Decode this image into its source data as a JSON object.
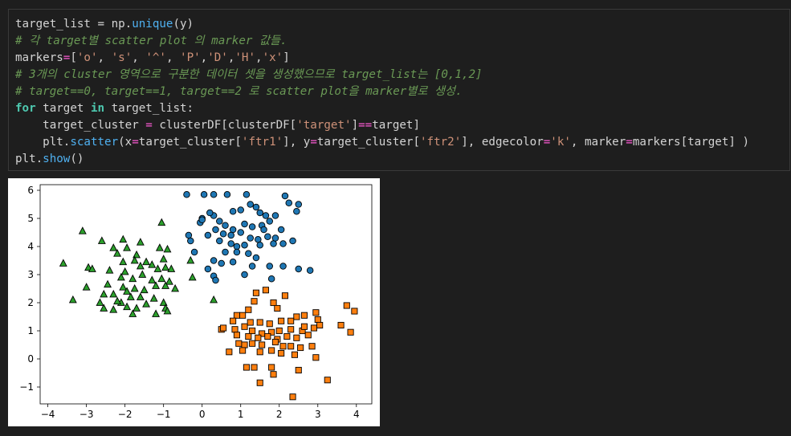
{
  "code_cell": {
    "lines": [
      [
        {
          "t": "target_list = np.",
          "c": "n"
        },
        {
          "t": "unique",
          "c": "fn"
        },
        {
          "t": "(y)",
          "c": "n"
        }
      ],
      [
        {
          "t": "# 각 target별 scatter plot 의 marker 값들.",
          "c": "c"
        }
      ],
      [
        {
          "t": "markers",
          "c": "n"
        },
        {
          "t": "=",
          "c": "o"
        },
        {
          "t": "[",
          "c": "n"
        },
        {
          "t": "'o'",
          "c": "s"
        },
        {
          "t": ", ",
          "c": "n"
        },
        {
          "t": "'s'",
          "c": "s"
        },
        {
          "t": ", ",
          "c": "n"
        },
        {
          "t": "'^'",
          "c": "s"
        },
        {
          "t": ", ",
          "c": "n"
        },
        {
          "t": "'P'",
          "c": "s"
        },
        {
          "t": ",",
          "c": "n"
        },
        {
          "t": "'D'",
          "c": "s"
        },
        {
          "t": ",",
          "c": "n"
        },
        {
          "t": "'H'",
          "c": "s"
        },
        {
          "t": ",",
          "c": "n"
        },
        {
          "t": "'x'",
          "c": "s"
        },
        {
          "t": "]",
          "c": "n"
        }
      ],
      [
        {
          "t": "# 3개의 cluster 영역으로 구분한 데이터 셋을 생성했으므로 target_list는 [0,1,2]",
          "c": "c"
        }
      ],
      [
        {
          "t": "# target==0, target==1, target==2 로 scatter plot을 marker별로 생성.",
          "c": "c"
        }
      ],
      [
        {
          "t": "for",
          "c": "k"
        },
        {
          "t": " target ",
          "c": "n"
        },
        {
          "t": "in",
          "c": "k"
        },
        {
          "t": " target_list:",
          "c": "n"
        }
      ],
      [
        {
          "t": "    target_cluster ",
          "c": "n"
        },
        {
          "t": "=",
          "c": "o"
        },
        {
          "t": " clusterDF[clusterDF[",
          "c": "n"
        },
        {
          "t": "'target'",
          "c": "s"
        },
        {
          "t": "]",
          "c": "n"
        },
        {
          "t": "==",
          "c": "o"
        },
        {
          "t": "target]",
          "c": "n"
        }
      ],
      [
        {
          "t": "    plt.",
          "c": "n"
        },
        {
          "t": "scatter",
          "c": "fn"
        },
        {
          "t": "(x",
          "c": "n"
        },
        {
          "t": "=",
          "c": "o"
        },
        {
          "t": "target_cluster[",
          "c": "n"
        },
        {
          "t": "'ftr1'",
          "c": "s"
        },
        {
          "t": "], y",
          "c": "n"
        },
        {
          "t": "=",
          "c": "o"
        },
        {
          "t": "target_cluster[",
          "c": "n"
        },
        {
          "t": "'ftr2'",
          "c": "s"
        },
        {
          "t": "], edgecolor",
          "c": "n"
        },
        {
          "t": "=",
          "c": "o"
        },
        {
          "t": "'k'",
          "c": "s"
        },
        {
          "t": ", marker",
          "c": "n"
        },
        {
          "t": "=",
          "c": "o"
        },
        {
          "t": "markers[target] )",
          "c": "n"
        }
      ],
      [
        {
          "t": "plt.",
          "c": "n"
        },
        {
          "t": "show",
          "c": "fn"
        },
        {
          "t": "()",
          "c": "n"
        }
      ]
    ]
  },
  "chart_data": {
    "type": "scatter",
    "xlim": [
      -4.2,
      4.4
    ],
    "ylim": [
      -1.6,
      6.2
    ],
    "xticks": [
      -4,
      -3,
      -2,
      -1,
      0,
      1,
      2,
      3,
      4
    ],
    "yticks": [
      -1,
      0,
      1,
      2,
      3,
      4,
      5,
      6
    ],
    "grid": false,
    "series": [
      {
        "marker": "o",
        "color": "#1f77b4",
        "points": [
          [
            -0.4,
            5.85
          ],
          [
            0.05,
            5.85
          ],
          [
            0.3,
            5.85
          ],
          [
            0.65,
            5.85
          ],
          [
            1.15,
            5.85
          ],
          [
            2.15,
            5.8
          ],
          [
            2.25,
            5.55
          ],
          [
            2.5,
            5.5
          ],
          [
            1.25,
            5.5
          ],
          [
            1.4,
            5.4
          ],
          [
            1.0,
            5.3
          ],
          [
            0.8,
            5.25
          ],
          [
            1.5,
            5.2
          ],
          [
            1.65,
            5.1
          ],
          [
            1.9,
            5.1
          ],
          [
            2.45,
            5.25
          ],
          [
            0.3,
            5.1
          ],
          [
            0.2,
            5.2
          ],
          [
            0.0,
            5.0
          ],
          [
            -0.05,
            4.85
          ],
          [
            0.45,
            4.9
          ],
          [
            0.6,
            4.75
          ],
          [
            0.8,
            4.6
          ],
          [
            1.1,
            4.8
          ],
          [
            1.3,
            4.7
          ],
          [
            1.55,
            4.75
          ],
          [
            1.75,
            4.9
          ],
          [
            2.05,
            4.6
          ],
          [
            0.35,
            4.6
          ],
          [
            0.15,
            4.4
          ],
          [
            0.55,
            4.45
          ],
          [
            0.75,
            4.4
          ],
          [
            1.0,
            4.5
          ],
          [
            1.25,
            4.3
          ],
          [
            1.45,
            4.25
          ],
          [
            1.7,
            4.35
          ],
          [
            0.45,
            4.2
          ],
          [
            0.75,
            4.1
          ],
          [
            0.9,
            4.0
          ],
          [
            1.1,
            4.05
          ],
          [
            1.5,
            4.05
          ],
          [
            1.85,
            4.1
          ],
          [
            2.1,
            4.1
          ],
          [
            0.6,
            3.8
          ],
          [
            0.9,
            3.8
          ],
          [
            1.2,
            3.75
          ],
          [
            1.4,
            3.6
          ],
          [
            0.3,
            3.5
          ],
          [
            0.5,
            3.4
          ],
          [
            0.8,
            3.45
          ],
          [
            1.3,
            3.3
          ],
          [
            1.75,
            3.3
          ],
          [
            2.1,
            3.3
          ],
          [
            0.15,
            3.2
          ],
          [
            1.1,
            3.0
          ],
          [
            2.5,
            3.2
          ],
          [
            2.8,
            3.15
          ],
          [
            0.3,
            2.95
          ],
          [
            0.35,
            2.8
          ],
          [
            1.8,
            2.85
          ],
          [
            -0.2,
            3.8
          ],
          [
            -0.3,
            4.2
          ],
          [
            -0.35,
            4.4
          ],
          [
            0.0,
            4.95
          ],
          [
            1.6,
            4.6
          ],
          [
            1.9,
            4.3
          ],
          [
            2.35,
            4.2
          ]
        ]
      },
      {
        "marker": "s",
        "color": "#ff7f0e",
        "points": [
          [
            1.65,
            2.45
          ],
          [
            1.4,
            2.35
          ],
          [
            2.15,
            2.25
          ],
          [
            1.35,
            2.05
          ],
          [
            1.85,
            2.0
          ],
          [
            1.95,
            1.8
          ],
          [
            1.2,
            1.75
          ],
          [
            2.65,
            1.55
          ],
          [
            3.75,
            1.9
          ],
          [
            3.95,
            1.7
          ],
          [
            0.9,
            1.55
          ],
          [
            1.05,
            1.55
          ],
          [
            2.45,
            1.5
          ],
          [
            2.95,
            1.65
          ],
          [
            0.8,
            1.35
          ],
          [
            1.5,
            1.3
          ],
          [
            1.75,
            1.25
          ],
          [
            2.05,
            1.35
          ],
          [
            2.3,
            1.35
          ],
          [
            3.0,
            1.4
          ],
          [
            3.6,
            1.2
          ],
          [
            0.5,
            1.05
          ],
          [
            0.85,
            1.05
          ],
          [
            1.1,
            1.15
          ],
          [
            1.3,
            1.0
          ],
          [
            1.55,
            0.9
          ],
          [
            1.8,
            0.95
          ],
          [
            2.0,
            1.0
          ],
          [
            2.3,
            1.05
          ],
          [
            2.6,
            1.0
          ],
          [
            2.9,
            1.1
          ],
          [
            3.85,
            0.95
          ],
          [
            0.9,
            0.85
          ],
          [
            1.2,
            0.8
          ],
          [
            1.45,
            0.75
          ],
          [
            1.7,
            0.8
          ],
          [
            1.95,
            0.7
          ],
          [
            2.2,
            0.8
          ],
          [
            2.45,
            0.75
          ],
          [
            2.75,
            0.85
          ],
          [
            0.95,
            0.55
          ],
          [
            1.1,
            0.5
          ],
          [
            1.3,
            0.55
          ],
          [
            1.55,
            0.5
          ],
          [
            1.9,
            0.6
          ],
          [
            2.1,
            0.45
          ],
          [
            2.3,
            0.45
          ],
          [
            2.55,
            0.4
          ],
          [
            2.85,
            0.45
          ],
          [
            0.7,
            0.25
          ],
          [
            1.05,
            0.3
          ],
          [
            1.5,
            0.25
          ],
          [
            1.8,
            0.3
          ],
          [
            2.05,
            0.2
          ],
          [
            2.4,
            0.15
          ],
          [
            2.95,
            0.05
          ],
          [
            1.15,
            -0.3
          ],
          [
            1.35,
            -0.3
          ],
          [
            1.8,
            -0.3
          ],
          [
            1.85,
            -0.55
          ],
          [
            2.5,
            -0.4
          ],
          [
            1.5,
            -0.85
          ],
          [
            3.25,
            -0.75
          ],
          [
            2.35,
            -1.35
          ],
          [
            0.55,
            1.1
          ],
          [
            1.25,
            1.3
          ],
          [
            2.65,
            1.15
          ],
          [
            3.05,
            1.2
          ]
        ]
      },
      {
        "marker": "^",
        "color": "#2ca02c",
        "points": [
          [
            -1.05,
            4.85
          ],
          [
            -3.1,
            4.55
          ],
          [
            -2.6,
            4.2
          ],
          [
            -2.05,
            4.25
          ],
          [
            -1.6,
            4.15
          ],
          [
            -2.3,
            3.95
          ],
          [
            -1.95,
            3.95
          ],
          [
            -1.1,
            3.95
          ],
          [
            -0.9,
            3.9
          ],
          [
            -2.2,
            3.75
          ],
          [
            -1.7,
            3.7
          ],
          [
            -1.0,
            3.55
          ],
          [
            -0.3,
            3.5
          ],
          [
            -3.6,
            3.4
          ],
          [
            -2.05,
            3.45
          ],
          [
            -1.75,
            3.5
          ],
          [
            -1.45,
            3.45
          ],
          [
            -1.3,
            3.35
          ],
          [
            -1.6,
            3.3
          ],
          [
            -1.15,
            3.2
          ],
          [
            -0.95,
            3.25
          ],
          [
            -0.8,
            3.2
          ],
          [
            -2.95,
            3.25
          ],
          [
            -2.85,
            3.2
          ],
          [
            -2.4,
            3.15
          ],
          [
            -2.0,
            3.1
          ],
          [
            -1.55,
            3.0
          ],
          [
            -2.1,
            2.9
          ],
          [
            -1.8,
            2.85
          ],
          [
            -1.3,
            2.8
          ],
          [
            -1.05,
            2.85
          ],
          [
            -0.85,
            2.75
          ],
          [
            -0.25,
            2.9
          ],
          [
            -1.2,
            2.6
          ],
          [
            -0.95,
            2.6
          ],
          [
            -0.7,
            2.5
          ],
          [
            -2.45,
            2.65
          ],
          [
            -2.05,
            2.55
          ],
          [
            -1.95,
            2.4
          ],
          [
            -1.75,
            2.5
          ],
          [
            -1.5,
            2.45
          ],
          [
            -2.55,
            2.3
          ],
          [
            -2.3,
            2.3
          ],
          [
            -1.85,
            2.2
          ],
          [
            -1.6,
            2.2
          ],
          [
            -1.25,
            2.15
          ],
          [
            -3.0,
            2.55
          ],
          [
            -3.35,
            2.1
          ],
          [
            -2.65,
            2.0
          ],
          [
            -2.1,
            2.0
          ],
          [
            -1.95,
            1.85
          ],
          [
            -1.7,
            1.8
          ],
          [
            -1.0,
            2.0
          ],
          [
            -0.95,
            1.8
          ],
          [
            -2.3,
            1.75
          ],
          [
            -2.55,
            1.8
          ],
          [
            -1.8,
            1.6
          ],
          [
            -1.2,
            1.6
          ],
          [
            -0.9,
            1.7
          ],
          [
            0.3,
            2.1
          ],
          [
            -2.2,
            2.05
          ],
          [
            -1.45,
            1.95
          ]
        ]
      }
    ]
  }
}
